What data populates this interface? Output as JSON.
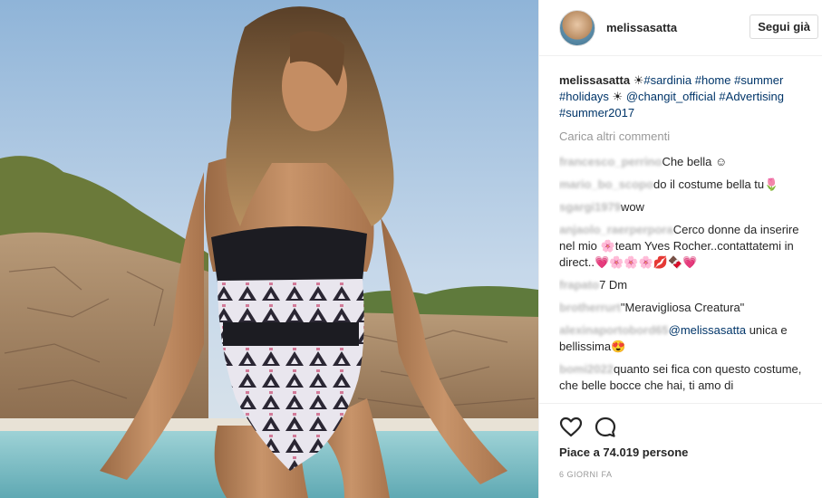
{
  "header": {
    "username": "melissasatta",
    "follow_label": "Segui già"
  },
  "caption": {
    "username": "melissasatta",
    "parts": [
      {
        "text": "☀",
        "tag": false
      },
      {
        "text": "#sardinia",
        "tag": true
      },
      {
        "text": " ",
        "tag": false
      },
      {
        "text": "#home",
        "tag": true
      },
      {
        "text": " ",
        "tag": false
      },
      {
        "text": "#summer",
        "tag": true
      },
      {
        "text": " ",
        "tag": false
      },
      {
        "text": "#holidays",
        "tag": true
      },
      {
        "text": " ☀ ",
        "tag": false
      },
      {
        "text": "@changit_official",
        "tag": true
      },
      {
        "text": " ",
        "tag": false
      },
      {
        "text": "#Advertising",
        "tag": true
      },
      {
        "text": " ",
        "tag": false
      },
      {
        "text": "#summer2017",
        "tag": true
      }
    ]
  },
  "load_more_label": "Carica altri commenti",
  "comments": [
    {
      "user": "francesco_perrino",
      "parts": [
        {
          "text": "Che bella ☺",
          "tag": false
        }
      ]
    },
    {
      "user": "mario_bo_scopo",
      "parts": [
        {
          "text": "do il costume bella tu🌷",
          "tag": false
        }
      ]
    },
    {
      "user": "sgargi1979",
      "parts": [
        {
          "text": "wow",
          "tag": false
        }
      ]
    },
    {
      "user": "anjaolo_raerperpora",
      "parts": [
        {
          "text": "Cerco donne da inserire nel mio 🌸team Yves Rocher..contattatemi in direct..💗🌸🌸🌸💋🍫💗",
          "tag": false
        }
      ]
    },
    {
      "user": "frapato",
      "parts": [
        {
          "text": "7 Dm",
          "tag": false
        }
      ]
    },
    {
      "user": "brotherrurt",
      "parts": [
        {
          "text": "\"Meravigliosa Creatura\"",
          "tag": false
        }
      ]
    },
    {
      "user": "alexinaportobord65",
      "parts": [
        {
          "text": "@melissasatta",
          "tag": true
        },
        {
          "text": " unica e bellissima😍",
          "tag": false
        }
      ]
    },
    {
      "user": "bomi2022",
      "parts": [
        {
          "text": "quanto sei fica con questo costume, che belle bocce che hai, ti amo di",
          "tag": false
        }
      ]
    }
  ],
  "actions": {
    "like_icon": "heart-outline-icon",
    "comment_icon": "speech-bubble-icon",
    "likes_text": "Piace a 74.019 persone",
    "time_ago": "6 GIORNI FA"
  },
  "colors": {
    "link": "#003569",
    "muted": "#999999",
    "border": "#efefef"
  }
}
